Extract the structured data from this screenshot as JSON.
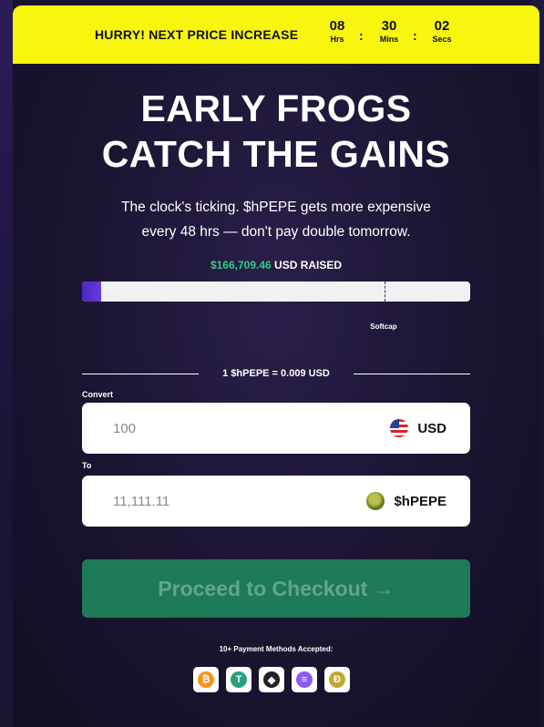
{
  "banner": {
    "text": "HURRY! NEXT PRICE INCREASE",
    "hours": "08",
    "hours_label": "Hrs",
    "minutes": "30",
    "minutes_label": "Mins",
    "seconds": "02",
    "seconds_label": "Secs",
    "separator": ":"
  },
  "hero": {
    "title_line1": "EARLY FROGS",
    "title_line2": "CATCH THE GAINS",
    "sub_line1": "The clock's ticking. $hPEPE gets more expensive",
    "sub_line2": "every 48 hrs — don't pay double tomorrow."
  },
  "raised": {
    "amount": "$166,709.46",
    "label": "USD RAISED",
    "progress_fraction": 0.05
  },
  "softcap": {
    "label": "Softcap",
    "fraction": 0.78
  },
  "rate": {
    "text": "1 $hPEPE = 0.009 USD"
  },
  "convert": {
    "label": "Convert",
    "value": "100",
    "currency": "USD",
    "currency_icon": "us-flag-icon"
  },
  "to": {
    "label": "To",
    "value": "11,111.11",
    "currency": "$hPEPE",
    "currency_icon": "hpepe-token-icon"
  },
  "checkout": {
    "label": "Proceed to Checkout →"
  },
  "payments": {
    "label": "10+ Payment Methods Accepted:",
    "methods": [
      {
        "icon": "bitcoin-icon",
        "symbol": "₿",
        "color": "#f7931a"
      },
      {
        "icon": "tether-icon",
        "symbol": "T",
        "color": "#26a17b"
      },
      {
        "icon": "ethereum-icon",
        "symbol": "◆",
        "color": "#222222"
      },
      {
        "icon": "solana-icon",
        "symbol": "≡",
        "color": "#8c5cf0"
      },
      {
        "icon": "dogecoin-icon",
        "symbol": "Ð",
        "color": "#c2a633"
      }
    ]
  },
  "colors": {
    "banner_bg": "#f8f60f",
    "raised_amount": "#2ecc8a",
    "checkout_bg": "#1f7a58",
    "progress_fill": "#4a28c2"
  }
}
